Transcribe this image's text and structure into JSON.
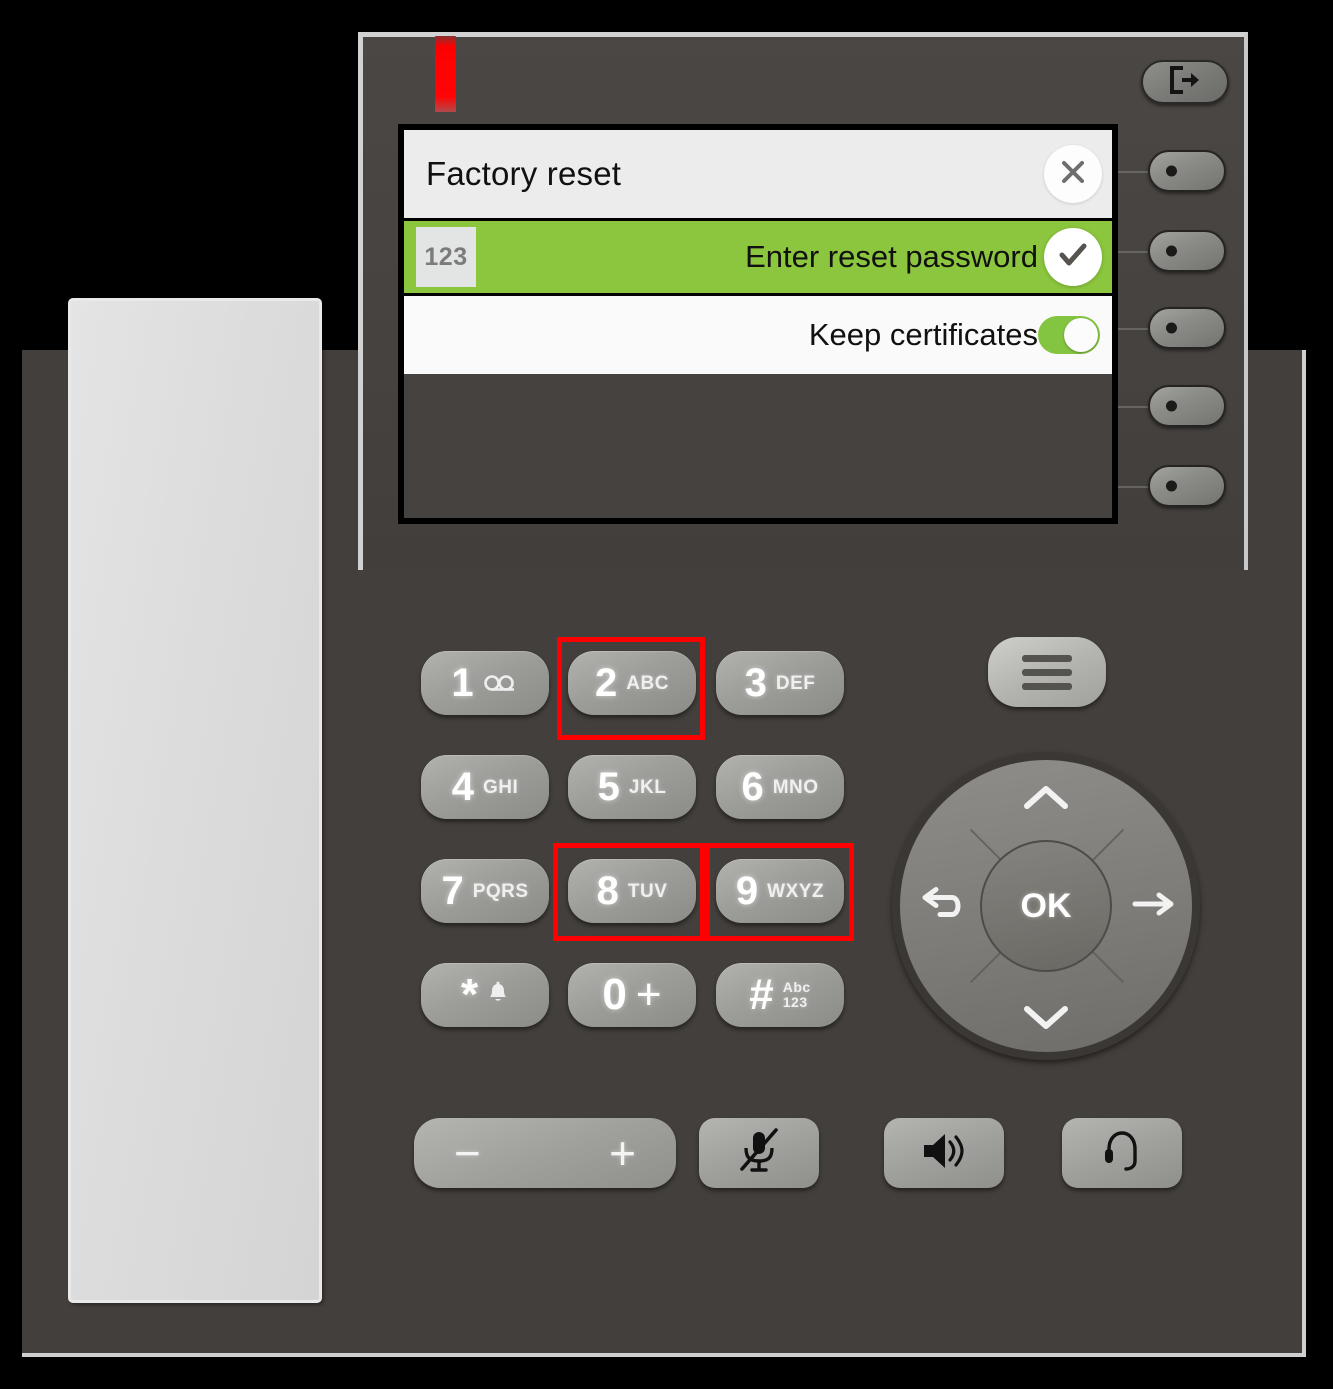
{
  "device": {
    "name": "desk-phone",
    "led_color": "#ff0000",
    "body_color": "#46423f",
    "accent_green": "#8cc63e",
    "highlight_color": "#fe0000"
  },
  "display": {
    "title": "Factory reset",
    "close_icon": "close-icon",
    "rows": [
      {
        "label": "Enter reset password",
        "badge": "123",
        "control": "checkmark",
        "selected": true
      },
      {
        "label": "Keep certificates",
        "badge": "",
        "control": "toggle-on",
        "selected": false
      }
    ]
  },
  "side_keys": {
    "logout_icon": "logout-icon",
    "count": 5
  },
  "keypad": [
    {
      "num": "1",
      "sub": "",
      "glyph": "voicemail-icon",
      "highlighted": false
    },
    {
      "num": "2",
      "sub": "ABC",
      "glyph": "",
      "highlighted": true
    },
    {
      "num": "3",
      "sub": "DEF",
      "glyph": "",
      "highlighted": false
    },
    {
      "num": "4",
      "sub": "GHI",
      "glyph": "",
      "highlighted": false
    },
    {
      "num": "5",
      "sub": "JKL",
      "glyph": "",
      "highlighted": false
    },
    {
      "num": "6",
      "sub": "MNO",
      "glyph": "",
      "highlighted": false
    },
    {
      "num": "7",
      "sub": "PQRS",
      "glyph": "",
      "highlighted": false
    },
    {
      "num": "8",
      "sub": "TUV",
      "glyph": "",
      "highlighted": true
    },
    {
      "num": "9",
      "sub": "WXYZ",
      "glyph": "",
      "highlighted": true
    },
    {
      "num": "*",
      "sub": "",
      "glyph": "bell-icon",
      "highlighted": false
    },
    {
      "num": "0",
      "sub": "+",
      "glyph": "",
      "highlighted": false
    },
    {
      "num": "#",
      "sub": "Abc\n123",
      "glyph": "",
      "highlighted": false
    }
  ],
  "nav": {
    "ok_label": "OK",
    "up_icon": "chevron-up-icon",
    "down_icon": "chevron-down-icon",
    "right_icon": "arrow-right-icon",
    "left_icon": "back-arrow-icon"
  },
  "menu_key": {
    "icon": "hamburger-menu-icon"
  },
  "function_keys": {
    "volume_down": "−",
    "volume_up": "+",
    "mute_icon": "microphone-muted-icon",
    "speaker_icon": "speaker-icon",
    "headset_icon": "headset-icon"
  }
}
